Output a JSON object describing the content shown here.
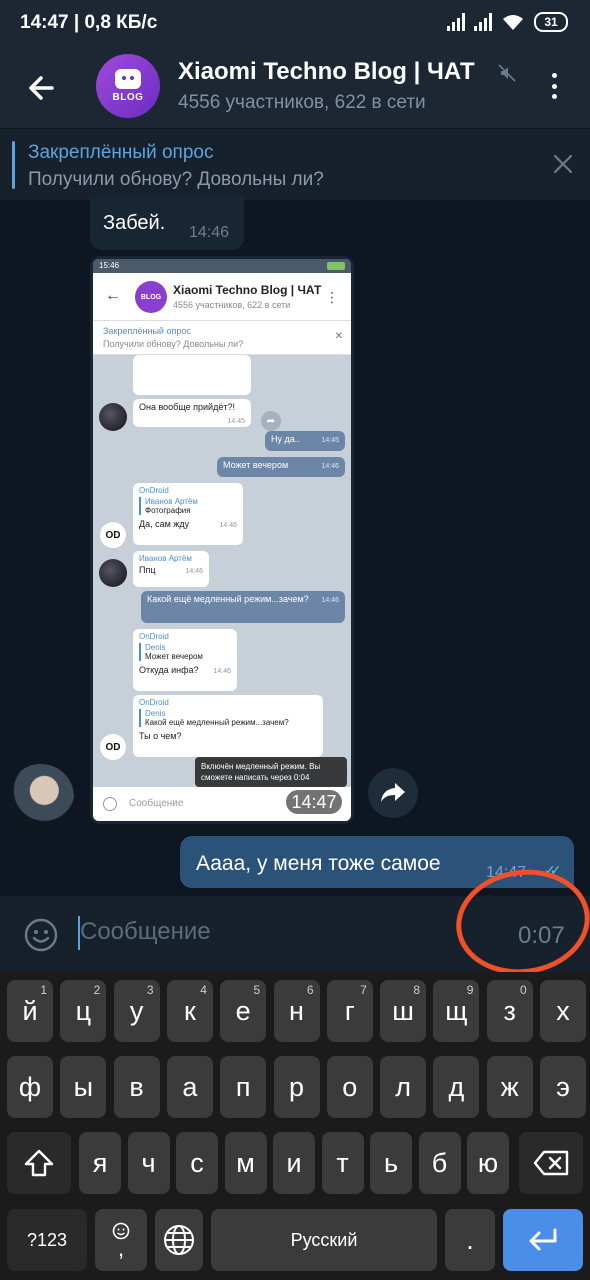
{
  "status_bar": {
    "time": "14:47 | 0,8 КБ/с",
    "battery": "31"
  },
  "header": {
    "avatar_text": "BLOG",
    "title": "Xiaomi Techno Blog | ЧАТ",
    "subtitle": "4556 участников, 622 в сети"
  },
  "pinned": {
    "title": "Закреплённый опрос",
    "text": "Получили обнову? Довольны ли?"
  },
  "messages": {
    "incoming_text": "Забей.",
    "incoming_time": "14:46",
    "photo_time": "14:47",
    "outgoing_text": "Аааа, у меня тоже самое",
    "outgoing_time": "14:47"
  },
  "screenshot": {
    "status_time": "15:46",
    "title": "Xiaomi Techno Blog | ЧАТ",
    "subtitle": "4556 участников, 622 в сети",
    "pinned_title": "Закреплённый опрос",
    "pinned_text": "Получили обнову? Довольны ли?",
    "m1_text": "Она вообще прийдёт?!",
    "m1_time": "14:45",
    "m2_text": "Ну да..",
    "m2_time": "14:45",
    "m3_text": "Может вечером",
    "m3_time": "14:46",
    "m4_name": "OnDroid",
    "m4_quote_name": "Иванов Артём",
    "m4_quote_text": "Фотография",
    "m4_text": "Да, сам жду",
    "m4_time": "14:46",
    "m5_name": "Иванов Артём",
    "m5_text": "Ппц",
    "m5_time": "14:46",
    "m6_text": "Какой ещё медленный режим...зачем?",
    "m6_time": "14:46",
    "m7_name": "OnDroid",
    "m7_quote_name": "Denis",
    "m7_quote_text": "Может вечером",
    "m7_text": "Откуда инфа?",
    "m7_time": "14:46",
    "m8_name": "OnDroid",
    "m8_quote_name": "Denis",
    "m8_quote_text": "Какой ещё медленный режим...зачем?",
    "m8_text": "Ты о чем?",
    "toast": "Включён медленный режим. Вы сможете написать через 0:04",
    "input_placeholder": "Сообщение",
    "od_avatar": "OD"
  },
  "input": {
    "placeholder": "Сообщение",
    "slow_mode_timer": "0:07"
  },
  "keyboard": {
    "row1": [
      {
        "k": "й",
        "h": "1"
      },
      {
        "k": "ц",
        "h": "2"
      },
      {
        "k": "у",
        "h": "3"
      },
      {
        "k": "к",
        "h": "4"
      },
      {
        "k": "е",
        "h": "5"
      },
      {
        "k": "н",
        "h": "6"
      },
      {
        "k": "г",
        "h": "7"
      },
      {
        "k": "ш",
        "h": "8"
      },
      {
        "k": "щ",
        "h": "9"
      },
      {
        "k": "з",
        "h": "0"
      },
      {
        "k": "х",
        "h": ""
      }
    ],
    "row2": [
      "ф",
      "ы",
      "в",
      "а",
      "п",
      "р",
      "о",
      "л",
      "д",
      "ж",
      "э"
    ],
    "row3": [
      "я",
      "ч",
      "с",
      "м",
      "и",
      "т",
      "ь",
      "б",
      "ю"
    ],
    "sym_label": "?123",
    "comma_label": ",",
    "space_label": "Русский",
    "period_label": "."
  },
  "colors": {
    "accent": "#5ea3de",
    "outgoing_bubble": "#2b5278",
    "incoming_bubble": "#182533",
    "highlight": "#f0502a",
    "enter_key": "#4b8ee9"
  }
}
